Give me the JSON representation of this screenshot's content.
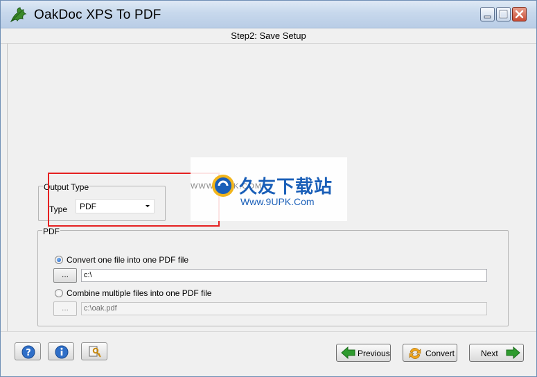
{
  "window": {
    "title": "OakDoc XPS To PDF",
    "icon": "oak-leaf-icon",
    "controls": [
      "minimize-icon",
      "maximize-icon",
      "close-icon"
    ]
  },
  "step": {
    "title": "Step2: Save Setup"
  },
  "output_type": {
    "group_label": "Output Type",
    "type_label": "Type",
    "selected": "PDF"
  },
  "pdf": {
    "group_label": "PDF",
    "option_one": {
      "label": "Convert one file into one PDF file",
      "checked": true,
      "path": "c:\\",
      "browse_label": "..."
    },
    "option_multi": {
      "label": "Combine multiple files into one PDF file",
      "checked": false,
      "path": "c:\\oak.pdf",
      "browse_label": "..."
    }
  },
  "watermark": {
    "url": "WWW.9UPK.COM",
    "title": "久友下载站",
    "subtitle": "Www.9UPK.Com"
  },
  "bottom_bar": {
    "help_icon": "question-icon",
    "info_icon": "info-icon",
    "register_icon": "key-icon",
    "previous_label": "Previous",
    "convert_label": "Convert",
    "next_label": "Next"
  },
  "colors": {
    "highlight_box": "#e52020",
    "accent_blue": "#1d5fc6",
    "arrow_green": "#2e9b2e"
  }
}
